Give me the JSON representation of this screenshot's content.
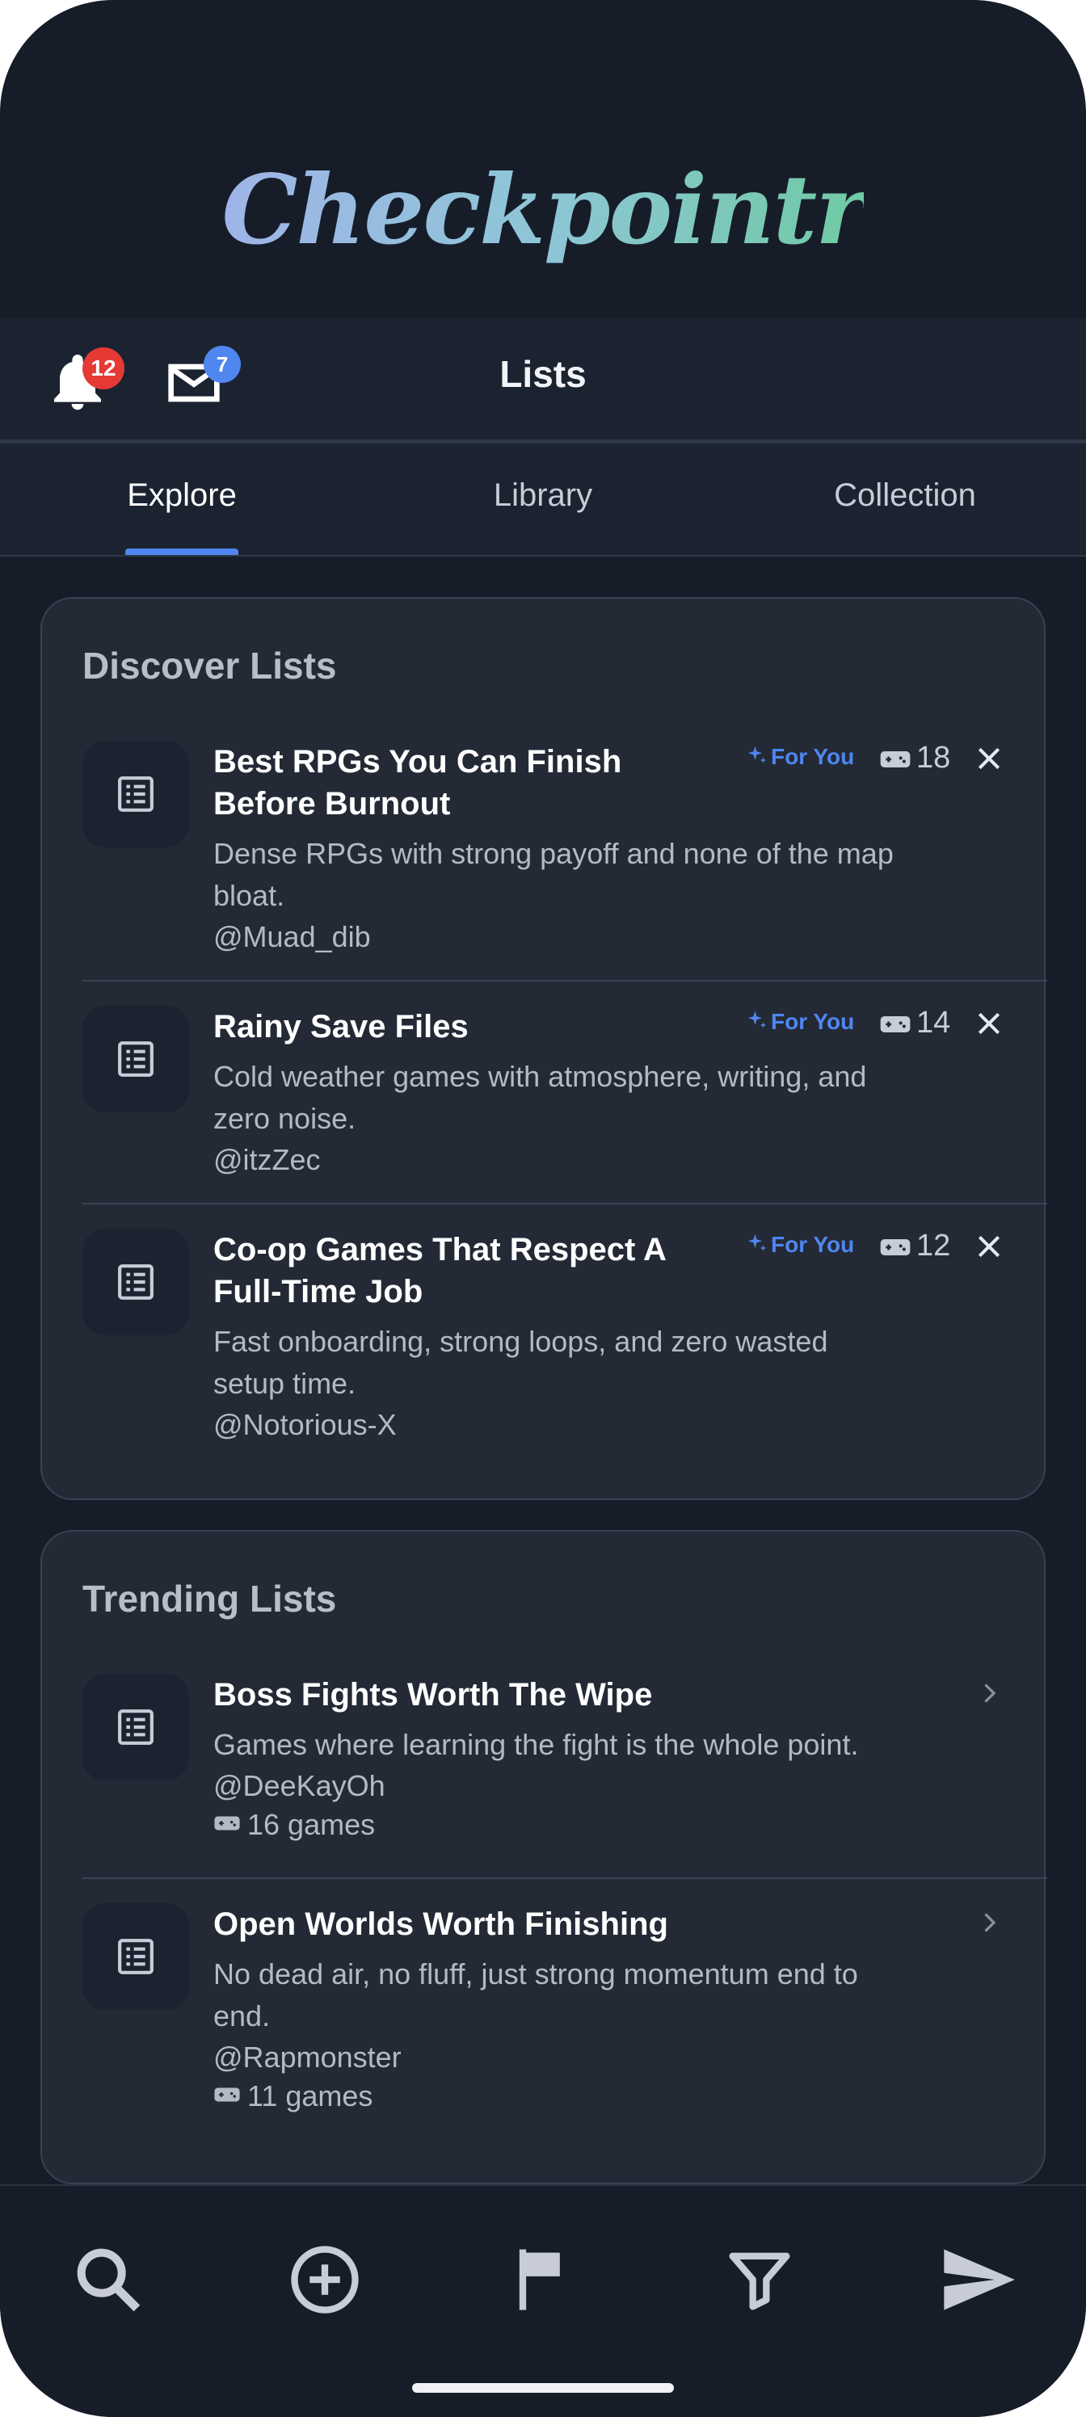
{
  "app": {
    "logo": "Checkpointr",
    "page_title": "Lists",
    "notifications_count": "12",
    "messages_count": "7"
  },
  "colors": {
    "accent": "#4f86f0",
    "badge_red": "#e53935",
    "badge_blue": "#4f86f0",
    "background": "#161d29",
    "card": "#232a36"
  },
  "tabs": [
    {
      "label": "Explore",
      "active": true
    },
    {
      "label": "Library",
      "active": false
    },
    {
      "label": "Collection",
      "active": false
    }
  ],
  "discover": {
    "heading": "Discover Lists",
    "items": [
      {
        "title_line1": "Best RPGs You Can Finish",
        "title_line2": "Before Burnout",
        "desc_line1": "Dense RPGs with strong payoff and none of the map",
        "desc_line2": "bloat.",
        "user": "@Muad_dib",
        "tag": "For You",
        "count": "18",
        "icon": "list-icon"
      },
      {
        "title_line1": "Rainy Save Files",
        "title_line2": "",
        "desc_line1": "Cold weather games with atmosphere, writing, and",
        "desc_line2": "zero noise.",
        "user": "@itzZec",
        "tag": "For You",
        "count": "14",
        "icon": "list-icon"
      },
      {
        "title_line1": "Co-op Games That Respect A",
        "title_line2": "Full-Time Job",
        "desc_line1": "Fast onboarding, strong loops, and zero wasted",
        "desc_line2": "setup time.",
        "user": "@Notorious-X",
        "tag": "For You",
        "count": "12",
        "icon": "list-icon"
      }
    ]
  },
  "trending": {
    "heading": "Trending Lists",
    "items": [
      {
        "title": "Boss Fights Worth The Wipe",
        "desc_line1": "Games where learning the fight is the whole point.",
        "desc_line2": "",
        "user": "@DeeKayOh",
        "games": "16 games",
        "icon": "list-icon"
      },
      {
        "title": "Open Worlds Worth Finishing",
        "desc_line1": "No dead air, no fluff, just strong momentum end to",
        "desc_line2": "end.",
        "user": "@Rapmonster",
        "games": "11 games",
        "icon": "list-icon"
      }
    ]
  },
  "bottom_nav": [
    {
      "icon": "search-icon"
    },
    {
      "icon": "add-circle-icon"
    },
    {
      "icon": "flag-icon"
    },
    {
      "icon": "filter-icon"
    },
    {
      "icon": "send-icon"
    }
  ]
}
